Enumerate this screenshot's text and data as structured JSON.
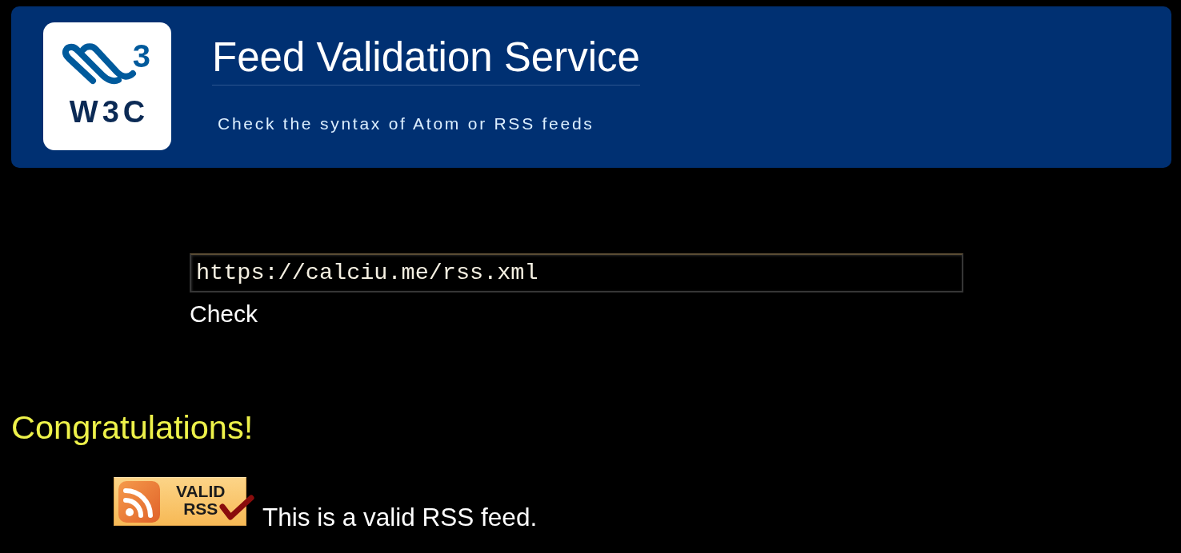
{
  "header": {
    "logo": {
      "superscript": "3",
      "wordmark": "W3C"
    },
    "title": "Feed Validation Service",
    "subtitle": "Check the syntax of Atom or RSS feeds"
  },
  "form": {
    "url_field": {
      "value": "https://calciu.me/rss.xml"
    },
    "button": "Check"
  },
  "result": {
    "heading": "Congratulations!",
    "badge": {
      "lines": [
        "VALID",
        "RSS"
      ]
    },
    "message": "This is a valid RSS feed."
  }
}
